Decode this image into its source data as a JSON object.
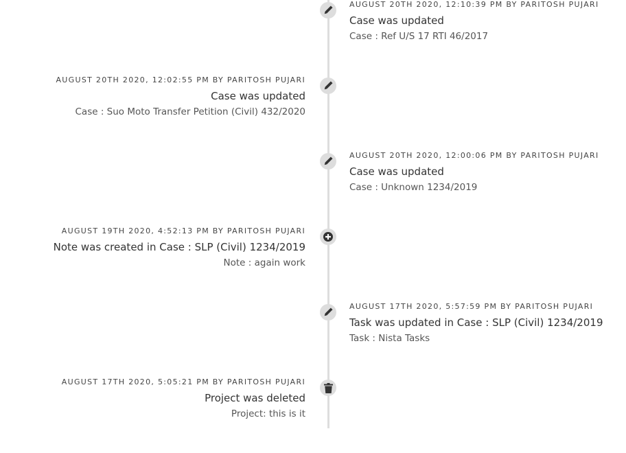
{
  "timeline": [
    {
      "side": "right",
      "icon": "pencil-icon",
      "meta": "AUGUST 20TH 2020, 12:10:39 PM BY PARITOSH PUJARI",
      "title": "Case was updated",
      "sub": "Case : Ref U/S 17 RTI 46/2017"
    },
    {
      "side": "left",
      "icon": "pencil-icon",
      "meta": "AUGUST 20TH 2020, 12:02:55 PM BY PARITOSH PUJARI",
      "title": "Case was updated",
      "sub": "Case : Suo Moto Transfer Petition (Civil) 432/2020"
    },
    {
      "side": "right",
      "icon": "pencil-icon",
      "meta": "AUGUST 20TH 2020, 12:00:06 PM BY PARITOSH PUJARI",
      "title": "Case was updated",
      "sub": "Case : Unknown 1234/2019"
    },
    {
      "side": "left",
      "icon": "plus-circle-icon",
      "meta": "AUGUST 19TH 2020, 4:52:13 PM BY PARITOSH PUJARI",
      "title": "Note was created in Case : SLP (Civil) 1234/2019",
      "sub": "Note : again work"
    },
    {
      "side": "right",
      "icon": "pencil-icon",
      "meta": "AUGUST 17TH 2020, 5:57:59 PM BY PARITOSH PUJARI",
      "title": "Task was updated in Case : SLP (Civil) 1234/2019",
      "sub": "Task : Nista Tasks"
    },
    {
      "side": "left",
      "icon": "trash-icon",
      "meta": "AUGUST 17TH 2020, 5:05:21 PM BY PARITOSH PUJARI",
      "title": "Project was deleted",
      "sub": "Project: this is it"
    }
  ]
}
